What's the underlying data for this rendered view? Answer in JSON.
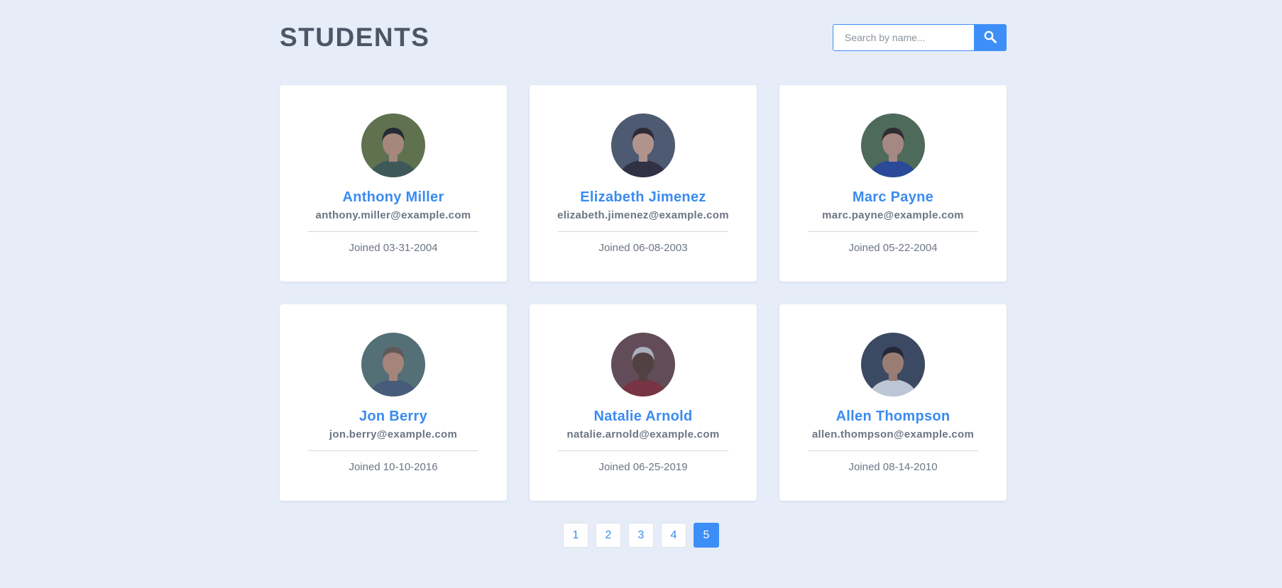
{
  "header": {
    "title": "STUDENTS",
    "search_placeholder": "Search by name...",
    "search_icon": "search-icon"
  },
  "students": [
    {
      "name": "Anthony Miller",
      "email": "anthony.miller@example.com",
      "joined": "Joined 03-31-2004",
      "avatar": {
        "bg": "#6d7b3f",
        "skin": "#c89a78",
        "hair": "#1f1c1a",
        "shirt": "#3f5a4c"
      }
    },
    {
      "name": "Elizabeth Jimenez",
      "email": "elizabeth.jimenez@example.com",
      "joined": "Joined 06-08-2003",
      "avatar": {
        "bg": "#555d6c",
        "skin": "#d7a990",
        "hair": "#2a1e1c",
        "shirt": "#2d2630"
      }
    },
    {
      "name": "Marc Payne",
      "email": "marc.payne@example.com",
      "joined": "Joined 05-22-2004",
      "avatar": {
        "bg": "#55724c",
        "skin": "#c99a80",
        "hair": "#2c1f1a",
        "shirt": "#2446a0"
      }
    },
    {
      "name": "Jon Berry",
      "email": "jon.berry@example.com",
      "joined": "Joined 10-10-2016",
      "avatar": {
        "bg": "#5c7a72",
        "skin": "#c89578",
        "hair": "#6b5a48",
        "shirt": "#4b5e78"
      }
    },
    {
      "name": "Natalie Arnold",
      "email": "natalie.arnold@example.com",
      "joined": "Joined 06-25-2019",
      "avatar": {
        "bg": "#6e4a4a",
        "skin": "#5a3b2c",
        "hair": "#cfcfcf",
        "shirt": "#8a2a30"
      }
    },
    {
      "name": "Allen Thompson",
      "email": "allen.thompson@example.com",
      "joined": "Joined 08-14-2010",
      "avatar": {
        "bg": "#3c4658",
        "skin": "#b88b70",
        "hair": "#1c1a1c",
        "shirt": "#e8ecf0"
      }
    }
  ],
  "pagination": {
    "pages": [
      "1",
      "2",
      "3",
      "4",
      "5"
    ],
    "active": "5"
  },
  "colors": {
    "accent": "#3d8ff7",
    "background": "#e6edf8",
    "title": "#4c5667"
  }
}
